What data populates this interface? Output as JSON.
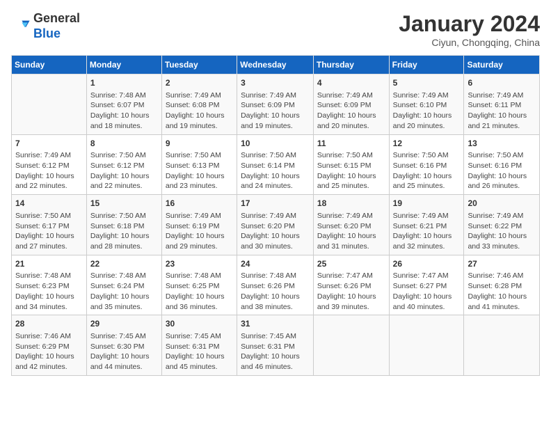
{
  "header": {
    "logo_general": "General",
    "logo_blue": "Blue",
    "month_title": "January 2024",
    "location": "Ciyun, Chongqing, China"
  },
  "days_of_week": [
    "Sunday",
    "Monday",
    "Tuesday",
    "Wednesday",
    "Thursday",
    "Friday",
    "Saturday"
  ],
  "weeks": [
    [
      {
        "day": "",
        "sunrise": "",
        "sunset": "",
        "daylight": ""
      },
      {
        "day": "1",
        "sunrise": "Sunrise: 7:48 AM",
        "sunset": "Sunset: 6:07 PM",
        "daylight": "Daylight: 10 hours and 18 minutes."
      },
      {
        "day": "2",
        "sunrise": "Sunrise: 7:49 AM",
        "sunset": "Sunset: 6:08 PM",
        "daylight": "Daylight: 10 hours and 19 minutes."
      },
      {
        "day": "3",
        "sunrise": "Sunrise: 7:49 AM",
        "sunset": "Sunset: 6:09 PM",
        "daylight": "Daylight: 10 hours and 19 minutes."
      },
      {
        "day": "4",
        "sunrise": "Sunrise: 7:49 AM",
        "sunset": "Sunset: 6:09 PM",
        "daylight": "Daylight: 10 hours and 20 minutes."
      },
      {
        "day": "5",
        "sunrise": "Sunrise: 7:49 AM",
        "sunset": "Sunset: 6:10 PM",
        "daylight": "Daylight: 10 hours and 20 minutes."
      },
      {
        "day": "6",
        "sunrise": "Sunrise: 7:49 AM",
        "sunset": "Sunset: 6:11 PM",
        "daylight": "Daylight: 10 hours and 21 minutes."
      }
    ],
    [
      {
        "day": "7",
        "sunrise": "Sunrise: 7:49 AM",
        "sunset": "Sunset: 6:12 PM",
        "daylight": "Daylight: 10 hours and 22 minutes."
      },
      {
        "day": "8",
        "sunrise": "Sunrise: 7:50 AM",
        "sunset": "Sunset: 6:12 PM",
        "daylight": "Daylight: 10 hours and 22 minutes."
      },
      {
        "day": "9",
        "sunrise": "Sunrise: 7:50 AM",
        "sunset": "Sunset: 6:13 PM",
        "daylight": "Daylight: 10 hours and 23 minutes."
      },
      {
        "day": "10",
        "sunrise": "Sunrise: 7:50 AM",
        "sunset": "Sunset: 6:14 PM",
        "daylight": "Daylight: 10 hours and 24 minutes."
      },
      {
        "day": "11",
        "sunrise": "Sunrise: 7:50 AM",
        "sunset": "Sunset: 6:15 PM",
        "daylight": "Daylight: 10 hours and 25 minutes."
      },
      {
        "day": "12",
        "sunrise": "Sunrise: 7:50 AM",
        "sunset": "Sunset: 6:16 PM",
        "daylight": "Daylight: 10 hours and 25 minutes."
      },
      {
        "day": "13",
        "sunrise": "Sunrise: 7:50 AM",
        "sunset": "Sunset: 6:16 PM",
        "daylight": "Daylight: 10 hours and 26 minutes."
      }
    ],
    [
      {
        "day": "14",
        "sunrise": "Sunrise: 7:50 AM",
        "sunset": "Sunset: 6:17 PM",
        "daylight": "Daylight: 10 hours and 27 minutes."
      },
      {
        "day": "15",
        "sunrise": "Sunrise: 7:50 AM",
        "sunset": "Sunset: 6:18 PM",
        "daylight": "Daylight: 10 hours and 28 minutes."
      },
      {
        "day": "16",
        "sunrise": "Sunrise: 7:49 AM",
        "sunset": "Sunset: 6:19 PM",
        "daylight": "Daylight: 10 hours and 29 minutes."
      },
      {
        "day": "17",
        "sunrise": "Sunrise: 7:49 AM",
        "sunset": "Sunset: 6:20 PM",
        "daylight": "Daylight: 10 hours and 30 minutes."
      },
      {
        "day": "18",
        "sunrise": "Sunrise: 7:49 AM",
        "sunset": "Sunset: 6:20 PM",
        "daylight": "Daylight: 10 hours and 31 minutes."
      },
      {
        "day": "19",
        "sunrise": "Sunrise: 7:49 AM",
        "sunset": "Sunset: 6:21 PM",
        "daylight": "Daylight: 10 hours and 32 minutes."
      },
      {
        "day": "20",
        "sunrise": "Sunrise: 7:49 AM",
        "sunset": "Sunset: 6:22 PM",
        "daylight": "Daylight: 10 hours and 33 minutes."
      }
    ],
    [
      {
        "day": "21",
        "sunrise": "Sunrise: 7:48 AM",
        "sunset": "Sunset: 6:23 PM",
        "daylight": "Daylight: 10 hours and 34 minutes."
      },
      {
        "day": "22",
        "sunrise": "Sunrise: 7:48 AM",
        "sunset": "Sunset: 6:24 PM",
        "daylight": "Daylight: 10 hours and 35 minutes."
      },
      {
        "day": "23",
        "sunrise": "Sunrise: 7:48 AM",
        "sunset": "Sunset: 6:25 PM",
        "daylight": "Daylight: 10 hours and 36 minutes."
      },
      {
        "day": "24",
        "sunrise": "Sunrise: 7:48 AM",
        "sunset": "Sunset: 6:26 PM",
        "daylight": "Daylight: 10 hours and 38 minutes."
      },
      {
        "day": "25",
        "sunrise": "Sunrise: 7:47 AM",
        "sunset": "Sunset: 6:26 PM",
        "daylight": "Daylight: 10 hours and 39 minutes."
      },
      {
        "day": "26",
        "sunrise": "Sunrise: 7:47 AM",
        "sunset": "Sunset: 6:27 PM",
        "daylight": "Daylight: 10 hours and 40 minutes."
      },
      {
        "day": "27",
        "sunrise": "Sunrise: 7:46 AM",
        "sunset": "Sunset: 6:28 PM",
        "daylight": "Daylight: 10 hours and 41 minutes."
      }
    ],
    [
      {
        "day": "28",
        "sunrise": "Sunrise: 7:46 AM",
        "sunset": "Sunset: 6:29 PM",
        "daylight": "Daylight: 10 hours and 42 minutes."
      },
      {
        "day": "29",
        "sunrise": "Sunrise: 7:45 AM",
        "sunset": "Sunset: 6:30 PM",
        "daylight": "Daylight: 10 hours and 44 minutes."
      },
      {
        "day": "30",
        "sunrise": "Sunrise: 7:45 AM",
        "sunset": "Sunset: 6:31 PM",
        "daylight": "Daylight: 10 hours and 45 minutes."
      },
      {
        "day": "31",
        "sunrise": "Sunrise: 7:45 AM",
        "sunset": "Sunset: 6:31 PM",
        "daylight": "Daylight: 10 hours and 46 minutes."
      },
      {
        "day": "",
        "sunrise": "",
        "sunset": "",
        "daylight": ""
      },
      {
        "day": "",
        "sunrise": "",
        "sunset": "",
        "daylight": ""
      },
      {
        "day": "",
        "sunrise": "",
        "sunset": "",
        "daylight": ""
      }
    ]
  ]
}
